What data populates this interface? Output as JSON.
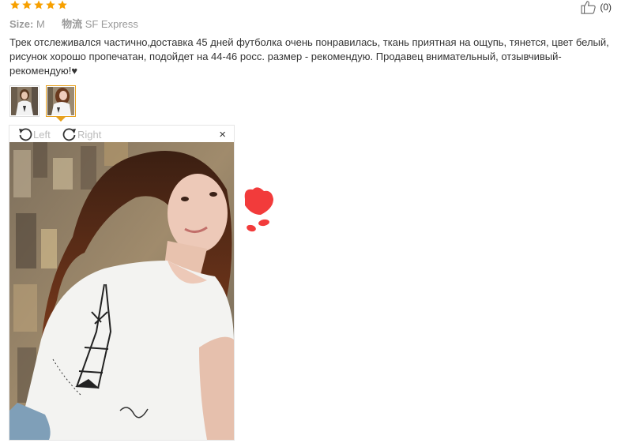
{
  "rating": {
    "stars": 5,
    "star_color": "#f7a000"
  },
  "like": {
    "icon": "thumbs-up-icon",
    "count": "(0)"
  },
  "meta": {
    "size_label": "Size:",
    "size_value": "M",
    "logistics_label": "物流",
    "logistics_value": "SF Express"
  },
  "review": {
    "text": "Трек отслеживался частично,доставка 45 дней футболка очень понравилась, ткань приятная на ощупь, тянется, цвет белый, рисунок хорошо пропечатан, подойдет на 44-46 росс. размер - рекомендую. Продавец внимательный, отзывчивый- рекомендую!♥"
  },
  "thumbnails": [
    {
      "name": "review-photo-1",
      "active": false
    },
    {
      "name": "review-photo-2",
      "active": true
    }
  ],
  "viewer": {
    "rotate_left_label": "Left",
    "rotate_right_label": "Right",
    "close_label": "×",
    "accent": "#e7a01c"
  }
}
